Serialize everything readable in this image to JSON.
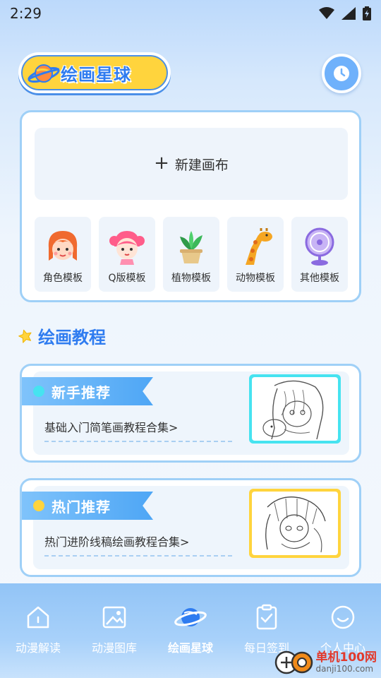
{
  "status_bar": {
    "time": "2:29"
  },
  "header": {
    "app_title": "绘画星球"
  },
  "canvas_card": {
    "new_canvas_label": "新建画布",
    "templates": [
      {
        "label": "角色模板",
        "icon": "girl-face-icon"
      },
      {
        "label": "Q版模板",
        "icon": "chibi-girl-icon"
      },
      {
        "label": "植物模板",
        "icon": "potted-plant-icon"
      },
      {
        "label": "动物模板",
        "icon": "giraffe-icon"
      },
      {
        "label": "其他模板",
        "icon": "electric-fan-icon"
      }
    ]
  },
  "tutorial_section": {
    "title": "绘画教程",
    "cards": [
      {
        "tag": "新手推荐",
        "link": "基础入门简笔画教程合集>",
        "dot_color": "#46e3f0",
        "frame_color": "#46e3f0"
      },
      {
        "tag": "热门推荐",
        "link": "热门进阶线稿绘画教程合集>",
        "dot_color": "#ffd43d",
        "frame_color": "#ffd43d"
      }
    ]
  },
  "bottom_nav": {
    "items": [
      {
        "label": "动漫解读",
        "icon": "house-icon",
        "active": false
      },
      {
        "label": "动漫图库",
        "icon": "image-icon",
        "active": false
      },
      {
        "label": "绘画星球",
        "icon": "planet-icon",
        "active": true
      },
      {
        "label": "每日签到",
        "icon": "clipboard-check-icon",
        "active": false
      },
      {
        "label": "个人中心",
        "icon": "smile-face-icon",
        "active": false
      }
    ]
  },
  "watermark": {
    "title": "单机100网",
    "url": "danji100.com"
  },
  "colors": {
    "accent": "#2f7cf0",
    "title_pill": "#ffd43d",
    "card_border": "#9fd0f7",
    "nav_bg": "#92c4f6"
  }
}
